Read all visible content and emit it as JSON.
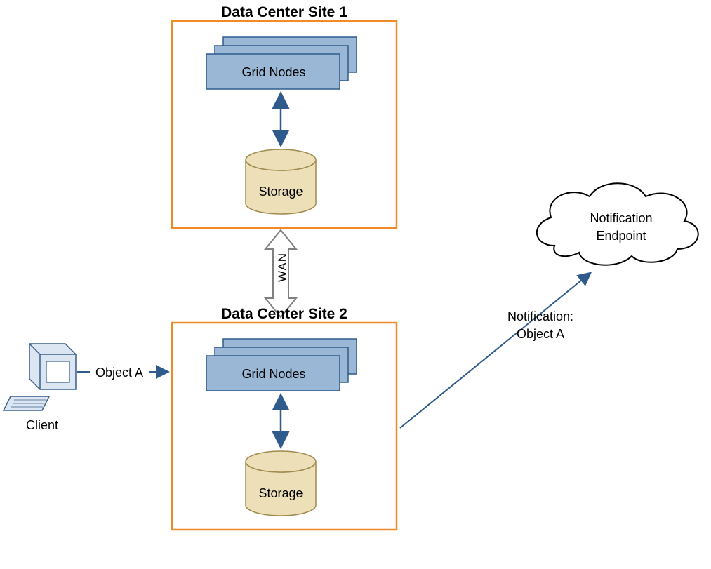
{
  "site1": {
    "title": "Data Center Site 1",
    "grid_label": "Grid Nodes",
    "storage_label": "Storage"
  },
  "site2": {
    "title": "Data Center Site 2",
    "grid_label": "Grid Nodes",
    "storage_label": "Storage"
  },
  "wan_label": "WAN",
  "client_label": "Client",
  "object_a_label": "Object A",
  "notification_line1": "Notification:",
  "notification_line2": "Object A",
  "cloud_line1": "Notification",
  "cloud_line2": "Endpoint",
  "colors": {
    "site_border": "#F08C28",
    "node_fill": "#9AB8D5",
    "node_stroke": "#2E5B8B",
    "storage_fill": "#EDE0B9",
    "storage_stroke": "#9F8B4F",
    "arrow_blue": "#2E5B8B",
    "wan_stroke": "#B0B0B0",
    "client_fill": "#DCE6F2"
  }
}
